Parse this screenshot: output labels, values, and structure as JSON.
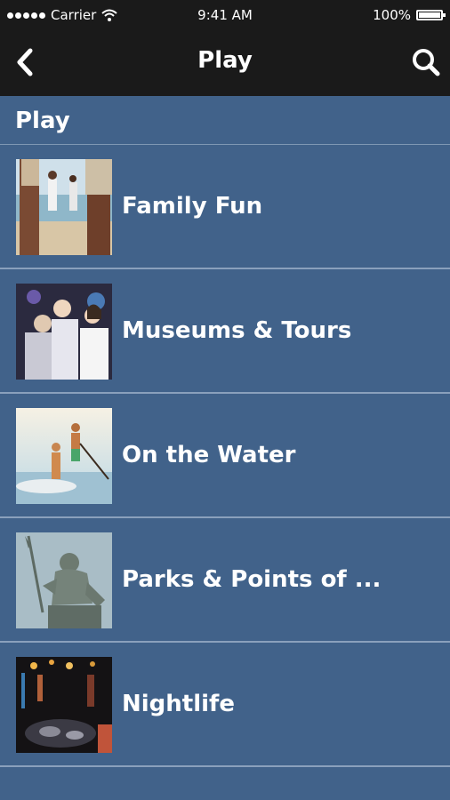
{
  "status_bar": {
    "carrier": "Carrier",
    "time": "9:41 AM",
    "battery": "100%"
  },
  "nav": {
    "title": "Play",
    "back_icon": "chevron-left-icon",
    "search_icon": "search-icon"
  },
  "section": {
    "title": "Play"
  },
  "items": [
    {
      "label": "Family Fun"
    },
    {
      "label": "Museums & Tours"
    },
    {
      "label": "On the Water"
    },
    {
      "label": "Parks & Points of ..."
    },
    {
      "label": "Nightlife"
    }
  ],
  "colors": {
    "background": "#41628a",
    "bar": "#1a1a1a",
    "divider": "#8aa0bc"
  }
}
